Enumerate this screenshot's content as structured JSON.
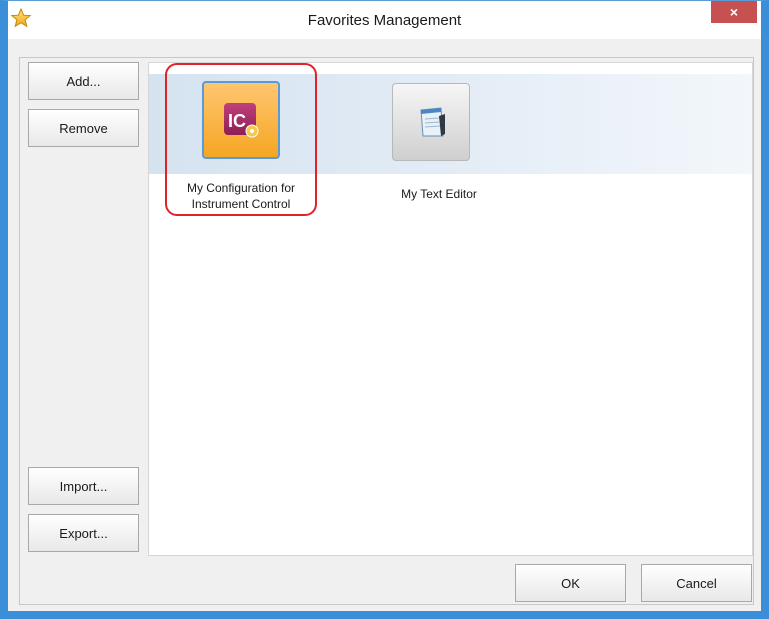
{
  "window": {
    "title": "Favorites Management",
    "close_glyph": "×",
    "accent_color": "#3a8fd8",
    "close_color": "#c75050",
    "title_icon": "star-icon"
  },
  "left_buttons": {
    "add_label": "Add...",
    "remove_label": "Remove",
    "import_label": "Import...",
    "export_label": "Export..."
  },
  "favorites": [
    {
      "label_line1": "My Configuration for",
      "label_line2": "Instrument Control",
      "icon": "instrument-control-config-icon",
      "icon_text": "IC",
      "selected": true
    },
    {
      "label_line1": "My Text Editor",
      "label_line2": "",
      "icon": "text-editor-icon",
      "selected": false
    }
  ],
  "footer": {
    "ok_label": "OK",
    "cancel_label": "Cancel"
  }
}
